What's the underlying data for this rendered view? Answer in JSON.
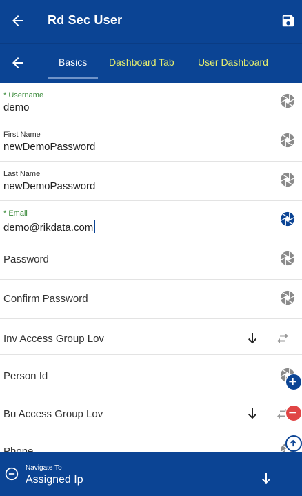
{
  "header": {
    "title": "Rd Sec User",
    "back_icon": "arrow-left-icon",
    "save_icon": "floppy-disk-icon"
  },
  "tabs": {
    "back_icon": "arrow-left-icon",
    "items": [
      {
        "label": "Basics",
        "active": true
      },
      {
        "label": "Dashboard Tab",
        "active": false
      },
      {
        "label": "User Dashboard",
        "active": false
      }
    ]
  },
  "form": {
    "username": {
      "label": "* Username",
      "value": "demo"
    },
    "first_name": {
      "label": "First Name",
      "value": "newDemoPassword"
    },
    "last_name": {
      "label": "Last Name",
      "value": "newDemoPassword"
    },
    "email": {
      "label": "* Email",
      "value": "demo@rikdata.com"
    },
    "password": {
      "label": "Password"
    },
    "confirm_password": {
      "label": "Confirm Password"
    },
    "inv_access_group": {
      "label": "Inv Access Group Lov"
    },
    "person_id": {
      "label": "Person Id"
    },
    "bu_access_group": {
      "label": "Bu Access Group Lov"
    },
    "phone": {
      "label": "Phone"
    }
  },
  "fabs": {
    "add_icon": "plus-circle-icon",
    "remove_icon": "minus-circle-icon",
    "up_icon": "arrow-up-circle-icon"
  },
  "navigate": {
    "caption": "Navigate To",
    "value": "Assigned Ip"
  },
  "colors": {
    "primary": "#0b4494",
    "tab_inactive": "#e6ee6e",
    "required_label": "#3a8a3a",
    "danger": "#e04545",
    "icon_gray": "#8a8a8a"
  }
}
